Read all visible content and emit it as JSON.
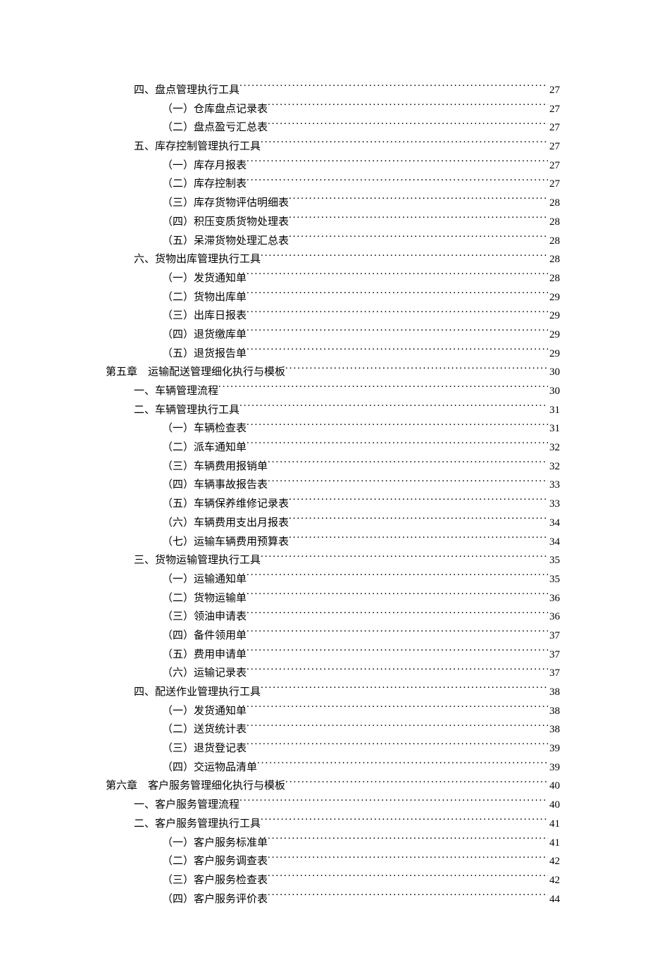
{
  "toc": [
    {
      "level": 1,
      "chapter": "",
      "text": "四、盘点管理执行工具",
      "page": "27"
    },
    {
      "level": 2,
      "chapter": "",
      "text": "（一）仓库盘点记录表",
      "page": "27"
    },
    {
      "level": 2,
      "chapter": "",
      "text": "（二）盘点盈亏汇总表",
      "page": "27"
    },
    {
      "level": 1,
      "chapter": "",
      "text": "五、库存控制管理执行工具",
      "page": "27"
    },
    {
      "level": 2,
      "chapter": "",
      "text": "（一）库存月报表",
      "page": "27"
    },
    {
      "level": 2,
      "chapter": "",
      "text": "（二）库存控制表",
      "page": "27"
    },
    {
      "level": 2,
      "chapter": "",
      "text": "（三）库存货物评估明细表",
      "page": "28"
    },
    {
      "level": 2,
      "chapter": "",
      "text": "（四）积压变质货物处理表",
      "page": "28"
    },
    {
      "level": 2,
      "chapter": "",
      "text": "（五）呆滞货物处理汇总表",
      "page": "28"
    },
    {
      "level": 1,
      "chapter": "",
      "text": "六、货物出库管理执行工具",
      "page": "28"
    },
    {
      "level": 2,
      "chapter": "",
      "text": "（一）发货通知单",
      "page": "28"
    },
    {
      "level": 2,
      "chapter": "",
      "text": "（二）货物出库单",
      "page": "29"
    },
    {
      "level": 2,
      "chapter": "",
      "text": "（三）出库日报表",
      "page": "29"
    },
    {
      "level": 2,
      "chapter": "",
      "text": "（四）退货缴库单",
      "page": "29"
    },
    {
      "level": 2,
      "chapter": "",
      "text": "（五）退货报告单",
      "page": "29"
    },
    {
      "level": 0,
      "chapter": "第五章",
      "text": "运输配送管理细化执行与模板",
      "page": "30"
    },
    {
      "level": 1,
      "chapter": "",
      "text": "一、车辆管理流程",
      "page": "30"
    },
    {
      "level": 1,
      "chapter": "",
      "text": "二、车辆管理执行工具",
      "page": "31"
    },
    {
      "level": 2,
      "chapter": "",
      "text": "（一）车辆检查表",
      "page": "31"
    },
    {
      "level": 2,
      "chapter": "",
      "text": "（二）派车通知单",
      "page": "32"
    },
    {
      "level": 2,
      "chapter": "",
      "text": "（三）车辆费用报销单",
      "page": "32"
    },
    {
      "level": 2,
      "chapter": "",
      "text": "（四）车辆事故报告表",
      "page": "33"
    },
    {
      "level": 2,
      "chapter": "",
      "text": "（五）车辆保养维修记录表",
      "page": "33"
    },
    {
      "level": 2,
      "chapter": "",
      "text": "（六）车辆费用支出月报表",
      "page": "34"
    },
    {
      "level": 2,
      "chapter": "",
      "text": "（七）运输车辆费用预算表",
      "page": "34"
    },
    {
      "level": 1,
      "chapter": "",
      "text": "三、货物运输管理执行工具",
      "page": "35"
    },
    {
      "level": 2,
      "chapter": "",
      "text": "（一）运输通知单",
      "page": "35"
    },
    {
      "level": 2,
      "chapter": "",
      "text": "（二）货物运输单",
      "page": "36"
    },
    {
      "level": 2,
      "chapter": "",
      "text": "（三）领油申请表",
      "page": "36"
    },
    {
      "level": 2,
      "chapter": "",
      "text": "（四）备件领用单",
      "page": "37"
    },
    {
      "level": 2,
      "chapter": "",
      "text": "（五）费用申请单",
      "page": "37"
    },
    {
      "level": 2,
      "chapter": "",
      "text": "（六）运输记录表",
      "page": "37"
    },
    {
      "level": 1,
      "chapter": "",
      "text": "四、配送作业管理执行工具",
      "page": "38"
    },
    {
      "level": 2,
      "chapter": "",
      "text": "（一）发货通知单",
      "page": "38"
    },
    {
      "level": 2,
      "chapter": "",
      "text": "（二）送货统计表",
      "page": "38"
    },
    {
      "level": 2,
      "chapter": "",
      "text": "（三）退货登记表",
      "page": "39"
    },
    {
      "level": 2,
      "chapter": "",
      "text": "（四）交运物品清单",
      "page": "39"
    },
    {
      "level": 0,
      "chapter": "第六章",
      "text": "客户服务管理细化执行与模板",
      "page": "40"
    },
    {
      "level": 1,
      "chapter": "",
      "text": "一、客户服务管理流程",
      "page": "40"
    },
    {
      "level": 1,
      "chapter": "",
      "text": "二、客户服务管理执行工具",
      "page": "41"
    },
    {
      "level": 2,
      "chapter": "",
      "text": "（一）客户服务标准单",
      "page": "41"
    },
    {
      "level": 2,
      "chapter": "",
      "text": "（二）客户服务调查表",
      "page": "42"
    },
    {
      "level": 2,
      "chapter": "",
      "text": "（三）客户服务检查表",
      "page": "42"
    },
    {
      "level": 2,
      "chapter": "",
      "text": "（四）客户服务评价表",
      "page": "44"
    }
  ]
}
